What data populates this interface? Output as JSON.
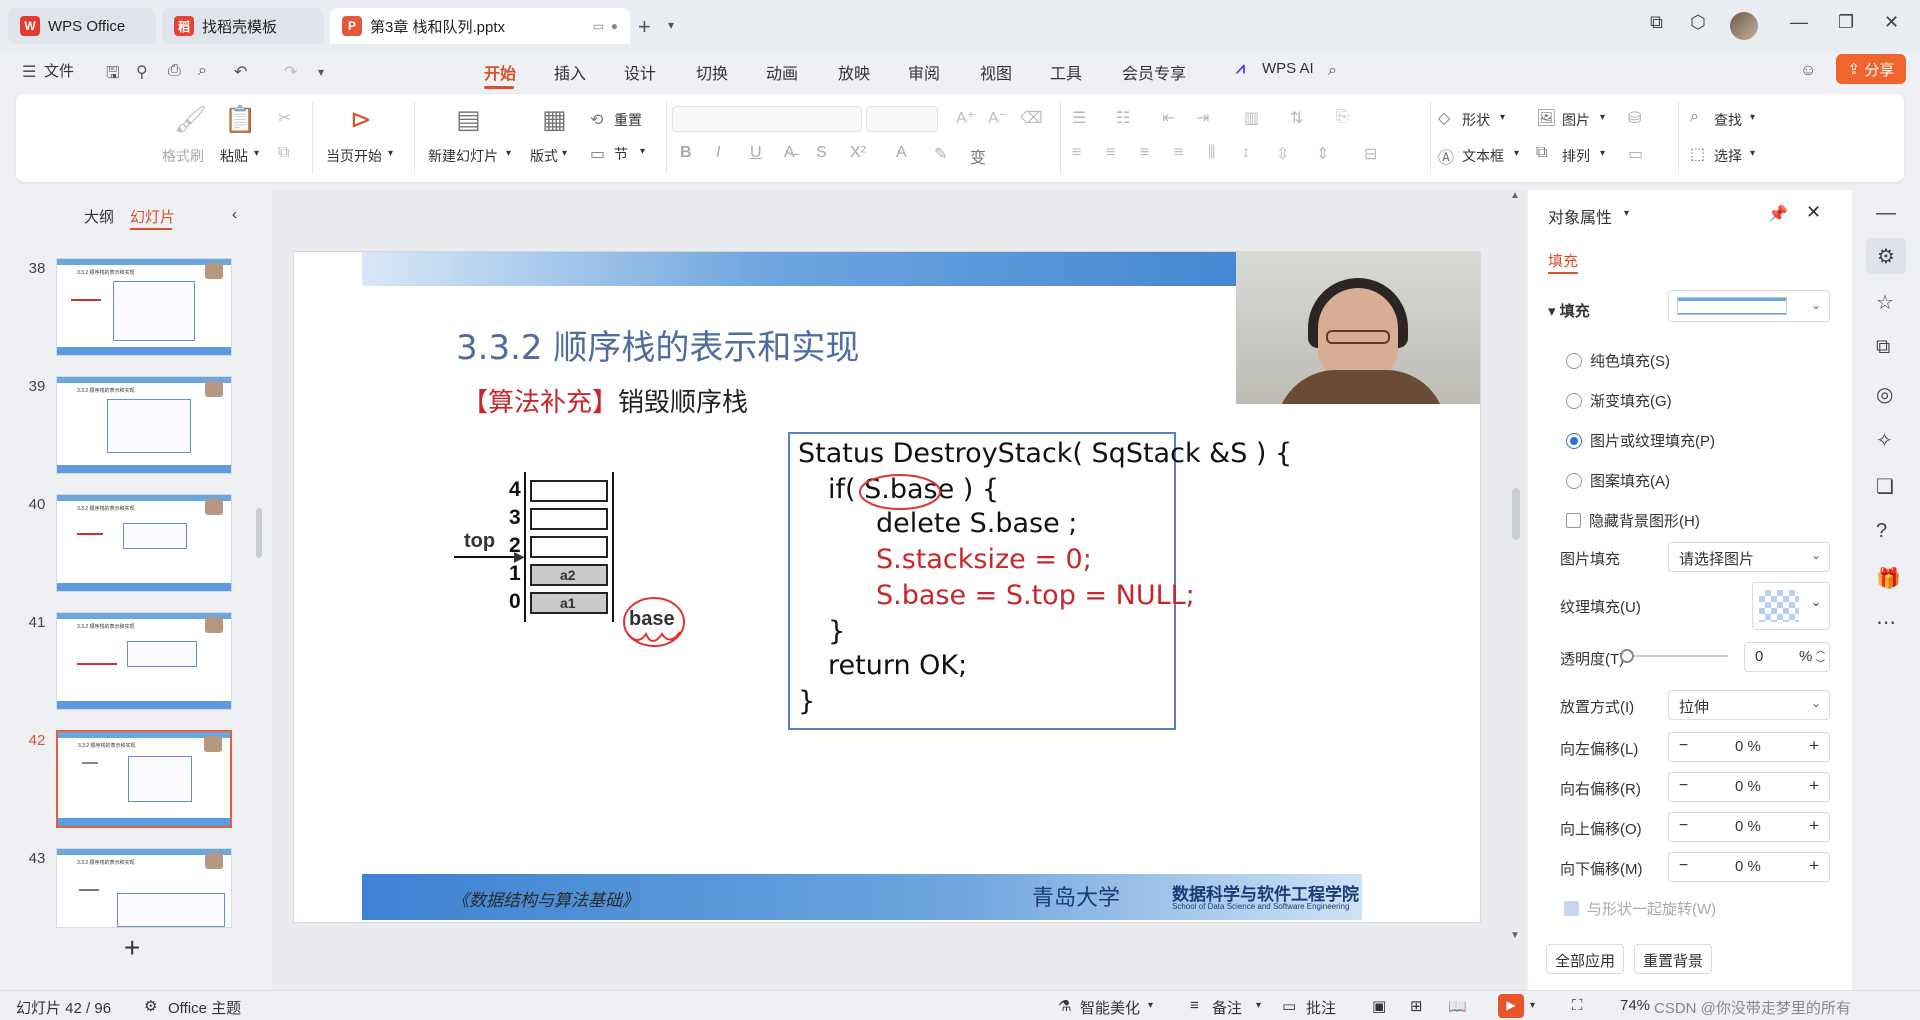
{
  "tabs": [
    {
      "label": "WPS Office",
      "logo": "W"
    },
    {
      "label": "找稻壳模板",
      "logo": "稻"
    },
    {
      "label": "第3章 栈和队列.pptx",
      "logo": "P"
    }
  ],
  "menu": {
    "file": "文件",
    "items": [
      "开始",
      "插入",
      "设计",
      "切换",
      "动画",
      "放映",
      "审阅",
      "视图",
      "工具",
      "会员专享"
    ],
    "active": "开始",
    "wps_ai": "WPS AI",
    "share": "分享"
  },
  "ribbon": {
    "format_painter": "格式刷",
    "paste": "粘贴",
    "play_current": "当页开始",
    "new_slide": "新建幻灯片",
    "layout": "版式",
    "section": "节",
    "reset": "重置",
    "shape": "形状",
    "picture": "图片",
    "textbox": "文本框",
    "arrange": "排列",
    "find": "查找",
    "select": "选择"
  },
  "left_panel": {
    "tab_outline": "大纲",
    "tab_slides": "幻灯片",
    "slides": [
      {
        "num": "38",
        "active": false
      },
      {
        "num": "39",
        "active": false
      },
      {
        "num": "40",
        "active": false
      },
      {
        "num": "41",
        "active": false
      },
      {
        "num": "42",
        "active": true
      },
      {
        "num": "43",
        "active": false
      }
    ]
  },
  "slide": {
    "title": "3.3.2 顺序栈的表示和实现",
    "subtitle_bracket": "【算法补充】",
    "subtitle_text": "销毁顺序栈",
    "stack_indices": [
      "4",
      "3",
      "2",
      "1",
      "0"
    ],
    "cell_a2": "a2",
    "cell_a1": "a1",
    "top_label": "top",
    "base_label": "base",
    "code": [
      "Status DestroyStack( SqStack &S ) {",
      "if( S.base ) {",
      "delete S.base ;",
      "S.stacksize = 0;",
      "S.base = S.top = NULL;",
      "}",
      "return OK;",
      "}"
    ],
    "footer_left": "《数据结构与算法基础》",
    "footer_university": "青岛大学",
    "footer_college": "数据科学与软件工程学院",
    "footer_college_en": "School of Data Science and Software Engineering"
  },
  "properties": {
    "title": "对象属性",
    "tab": "填充",
    "section": "填充",
    "options": [
      {
        "label": "纯色填充(S)",
        "selected": false
      },
      {
        "label": "渐变填充(G)",
        "selected": false
      },
      {
        "label": "图片或纹理填充(P)",
        "selected": true
      },
      {
        "label": "图案填充(A)",
        "selected": false
      }
    ],
    "hide_bg": "隐藏背景图形(H)",
    "picture_fill_label": "图片填充",
    "picture_fill_value": "请选择图片",
    "texture_label": "纹理填充(U)",
    "opacity_label": "透明度(T)",
    "opacity_value": "0",
    "opacity_unit": "%",
    "placement_label": "放置方式(I)",
    "placement_value": "拉伸",
    "offsets": [
      {
        "label": "向左偏移(L)",
        "value": "0 %"
      },
      {
        "label": "向右偏移(R)",
        "value": "0 %"
      },
      {
        "label": "向上偏移(O)",
        "value": "0 %"
      },
      {
        "label": "向下偏移(M)",
        "value": "0 %"
      }
    ],
    "rotate_with_shape": "与形状一起旋转(W)",
    "apply_all": "全部应用",
    "reset_bg": "重置背景"
  },
  "status": {
    "slide_count": "幻灯片 42 / 96",
    "theme": "Office 主题",
    "beautify": "智能美化",
    "notes": "备注",
    "comments": "批注",
    "zoom": "74%",
    "watermark": "CSDN @你没带走梦里的所有"
  },
  "colors": {
    "accent": "#d6532a",
    "share_bg": "#f0642d",
    "slide_title": "#4e6c9e",
    "code_red": "#c8262a",
    "code_border": "#5b7fc4"
  }
}
